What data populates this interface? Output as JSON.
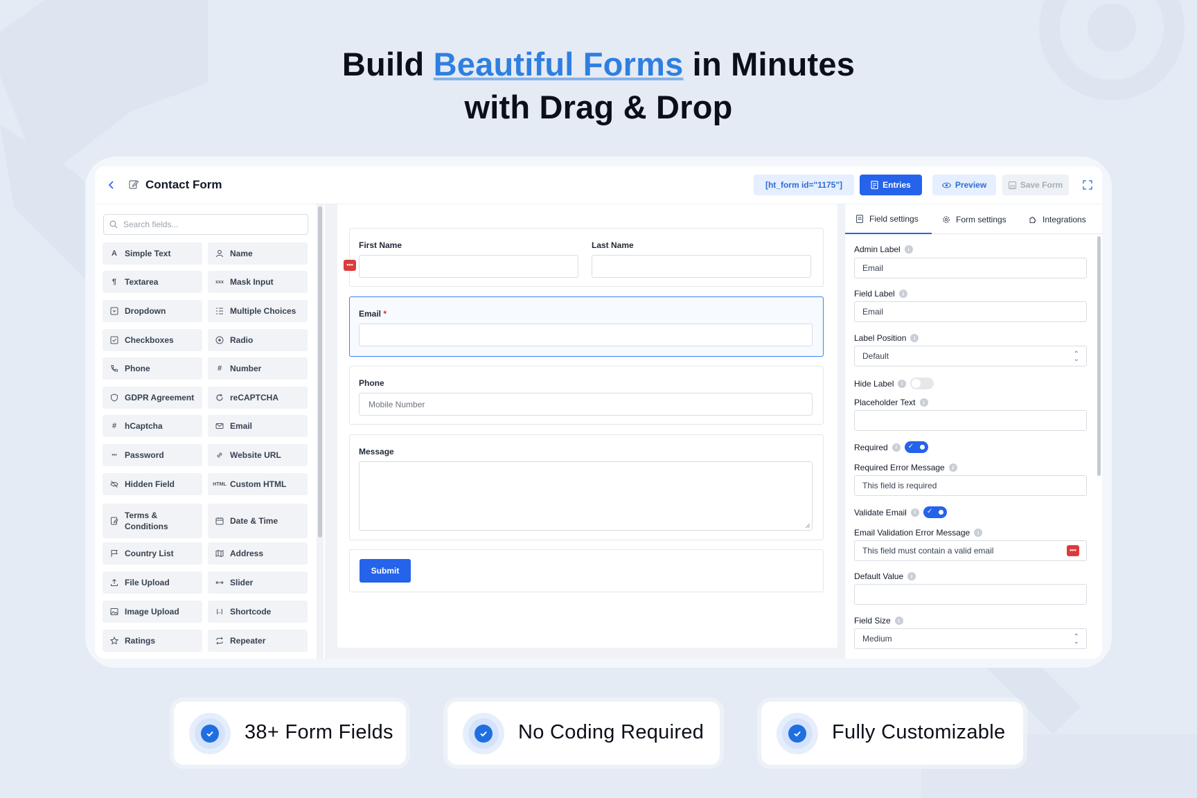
{
  "hero": {
    "line1_pre": "Build ",
    "line1_accent": "Beautiful Forms",
    "line1_post": " in Minutes",
    "line2": "with Drag & Drop"
  },
  "colors": {
    "accent": "#2563eb",
    "hero_accent": "#2f7fe0",
    "danger": "#dc3b3b"
  },
  "topbar": {
    "title": "Contact Form",
    "shortcode": "[ht_form id=\"1175\"]",
    "entries_label": "Entries",
    "preview_label": "Preview",
    "save_label": "Save Form"
  },
  "palette": {
    "search_placeholder": "Search fields...",
    "items": [
      {
        "label": "Simple Text",
        "icon": "A"
      },
      {
        "label": "Name",
        "icon": "user"
      },
      {
        "label": "Textarea",
        "icon": "¶"
      },
      {
        "label": "Mask Input",
        "icon": "xxx"
      },
      {
        "label": "Dropdown",
        "icon": "dropdown"
      },
      {
        "label": "Multiple Choices",
        "icon": "list"
      },
      {
        "label": "Checkboxes",
        "icon": "check"
      },
      {
        "label": "Radio",
        "icon": "radio"
      },
      {
        "label": "Phone",
        "icon": "phone"
      },
      {
        "label": "Number",
        "icon": "#"
      },
      {
        "label": "GDPR Agreement",
        "icon": "shield"
      },
      {
        "label": "reCAPTCHA",
        "icon": "refresh"
      },
      {
        "label": "hCaptcha",
        "icon": "#"
      },
      {
        "label": "Email",
        "icon": "mail"
      },
      {
        "label": "Password",
        "icon": "•••"
      },
      {
        "label": "Website URL",
        "icon": "link"
      },
      {
        "label": "Hidden Field",
        "icon": "eye-off"
      },
      {
        "label": "Custom HTML",
        "icon": "HTML"
      },
      {
        "label": "Terms & Conditions",
        "icon": "doc"
      },
      {
        "label": "Date & Time",
        "icon": "calendar"
      },
      {
        "label": "Country List",
        "icon": "flag"
      },
      {
        "label": "Address",
        "icon": "map"
      },
      {
        "label": "File Upload",
        "icon": "upload"
      },
      {
        "label": "Slider",
        "icon": "slider"
      },
      {
        "label": "Image Upload",
        "icon": "image"
      },
      {
        "label": "Shortcode",
        "icon": "[..]"
      },
      {
        "label": "Ratings",
        "icon": "star"
      },
      {
        "label": "Repeater",
        "icon": "repeat"
      }
    ]
  },
  "canvas": {
    "first_name": "First Name",
    "last_name": "Last Name",
    "email": "Email",
    "required_mark": "*",
    "phone": "Phone",
    "phone_placeholder": "Mobile Number",
    "message": "Message",
    "submit": "Submit",
    "drag_handle": "•••"
  },
  "settings": {
    "tabs": [
      "Field settings",
      "Form settings",
      "Integrations"
    ],
    "admin_label": "Admin Label",
    "admin_value": "Email",
    "field_label": "Field Label",
    "field_value": "Email",
    "label_position": "Label Position",
    "label_position_value": "Default",
    "hide_label": "Hide Label",
    "placeholder_text": "Placeholder Text",
    "placeholder_value": "",
    "required": "Required",
    "required_error": "Required Error Message",
    "required_error_value": "This field is required",
    "validate_email": "Validate Email",
    "email_error": "Email Validation Error Message",
    "email_error_value": "This field must contain a valid email",
    "default_value": "Default Value",
    "default_value_value": "",
    "field_size": "Field Size",
    "field_size_value": "Medium",
    "info": "i"
  },
  "features": [
    "38+ Form Fields",
    "No Coding Required",
    "Fully Customizable"
  ]
}
